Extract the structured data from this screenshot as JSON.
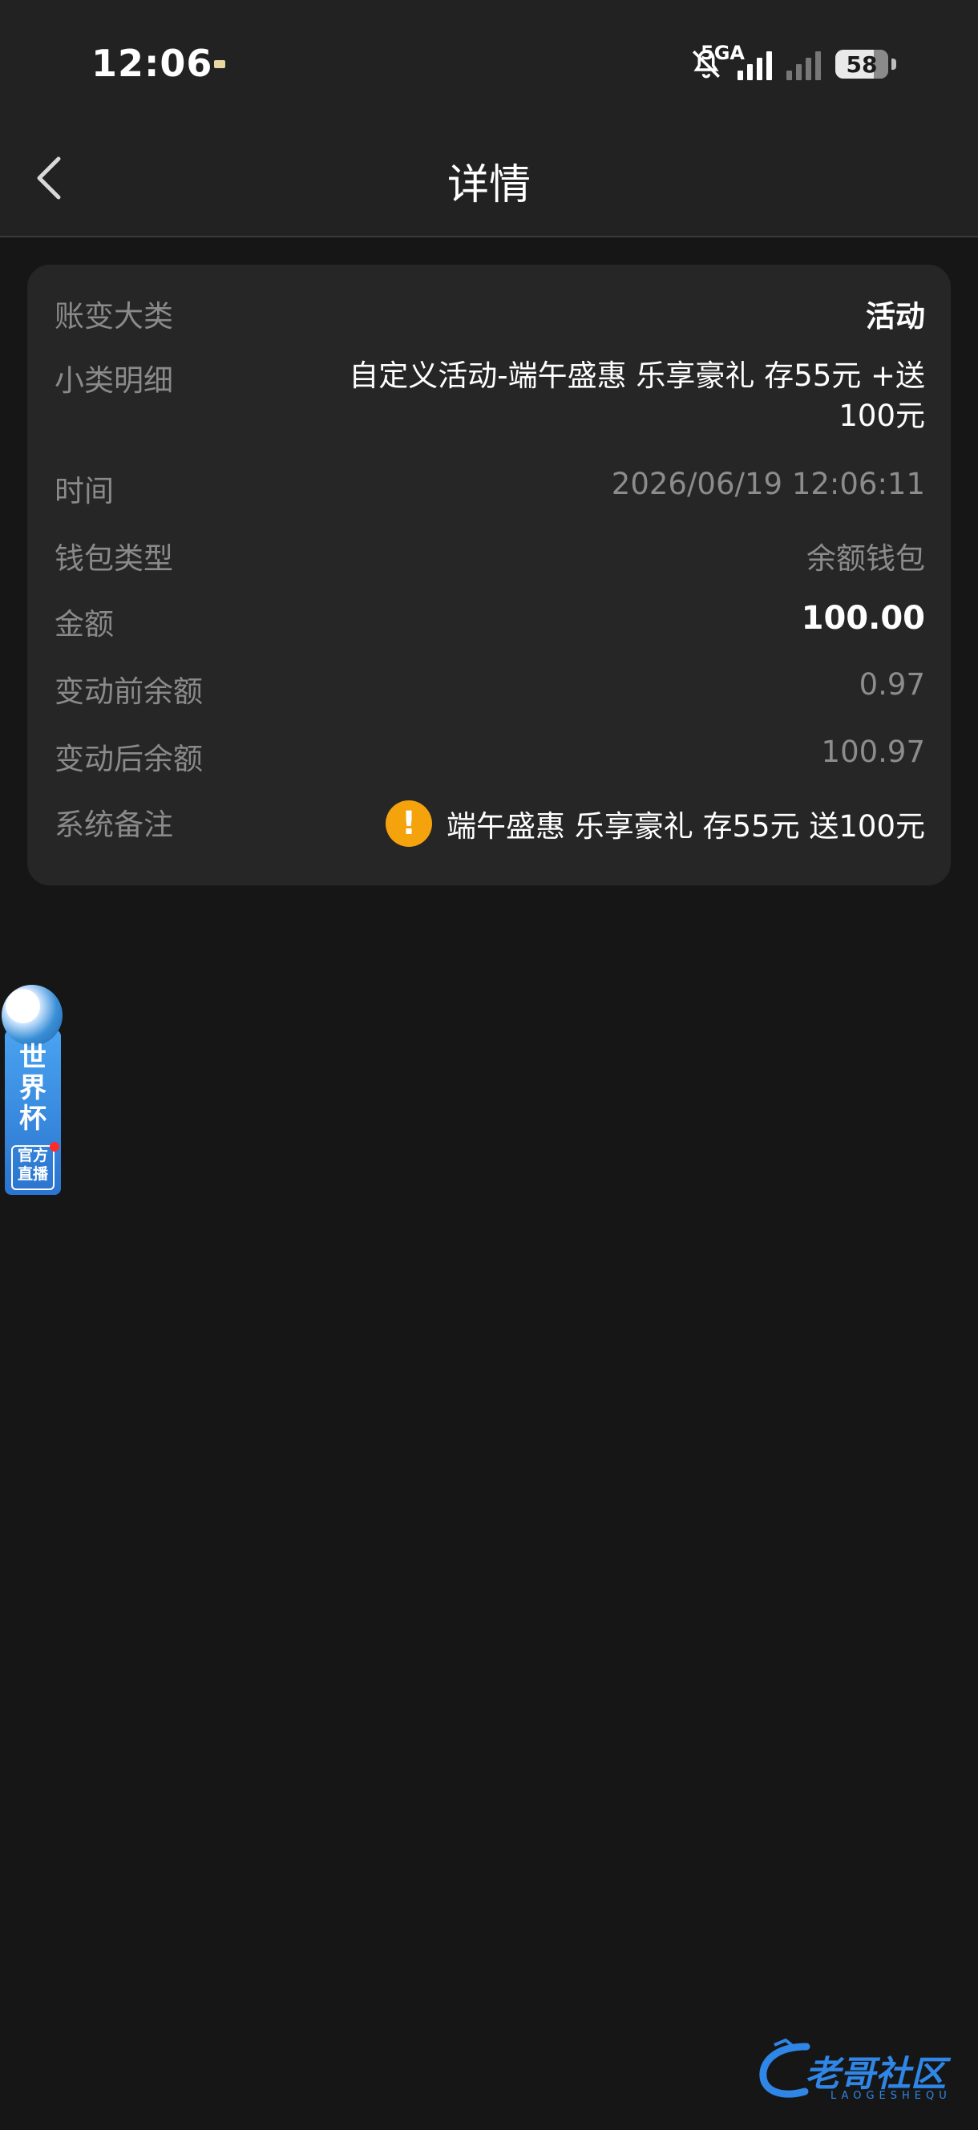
{
  "status_bar": {
    "time": "12:06",
    "network": "5GA",
    "battery": "58"
  },
  "header": {
    "title": "详情"
  },
  "details": [
    {
      "label": "账变大类",
      "value": "活动"
    },
    {
      "label": "小类明细",
      "value": "自定义活动-端午盛惠 乐享豪礼 存55元 +送100元"
    },
    {
      "label": "时间",
      "value": "2026/06/19 12:06:11"
    },
    {
      "label": "钱包类型",
      "value": "余额钱包"
    },
    {
      "label": "金额",
      "value": "100.00"
    },
    {
      "label": "变动前余额",
      "value": "0.97"
    },
    {
      "label": "变动后余额",
      "value": "100.97"
    },
    {
      "label": "系统备注",
      "value": "端午盛惠 乐享豪礼 存55元 送100元"
    }
  ],
  "floating_widget": {
    "title": "世界杯",
    "subtitle": "官方直播"
  },
  "watermark": {
    "text": "老哥社区",
    "sub": "LAOGESHEQU"
  },
  "colors": {
    "background": "#161616",
    "card": "#262626",
    "warning": "#f4a30c",
    "label": "#8a8a8a"
  }
}
